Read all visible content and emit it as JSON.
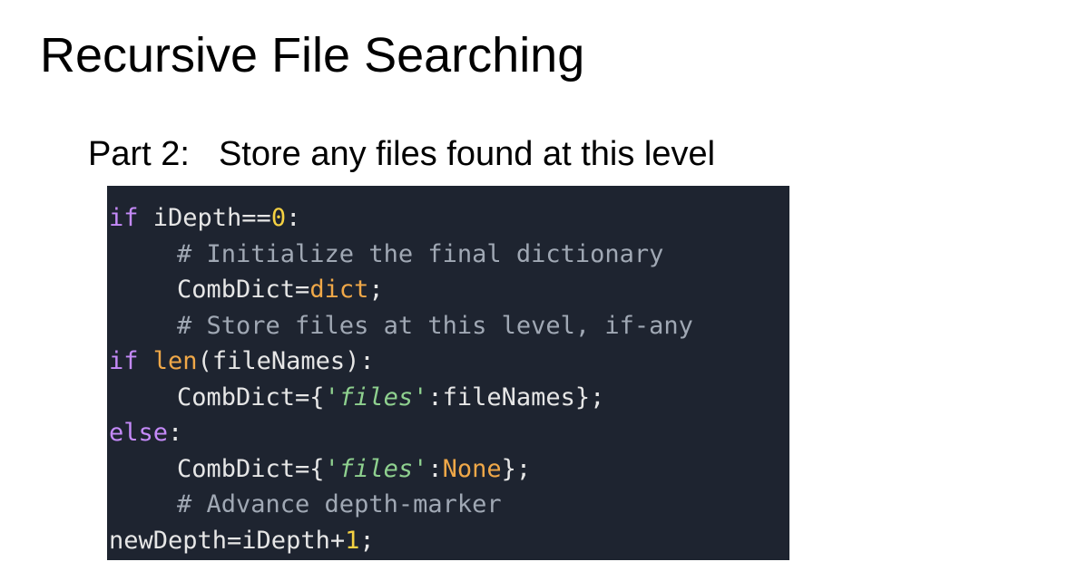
{
  "slide": {
    "title": "Recursive File Searching",
    "part_label": "Part 2:",
    "part_description": "Store any files found at this level"
  },
  "code": {
    "line1": {
      "kw": "if",
      "a": " iDepth==",
      "num": "0",
      "b": ":"
    },
    "line2": {
      "comment": "# Initialize the final dictionary"
    },
    "line3": {
      "a": "CombDict=",
      "builtin": "dict",
      "b": ";"
    },
    "line4": {
      "comment": "# Store files at this level, if-any"
    },
    "line5": {
      "kw": "if",
      "sp": " ",
      "builtin": "len",
      "b": "(fileNames):"
    },
    "line6": {
      "a": "CombDict={",
      "str": "'files'",
      "b": ":fileNames};"
    },
    "line7": {
      "kw": "else",
      "b": ":"
    },
    "line8": {
      "a": "CombDict={",
      "str": "'files'",
      "c": ":",
      "builtin": "None",
      "b": "};"
    },
    "line9": {
      "comment": "# Advance depth-marker"
    },
    "line10": {
      "a": "newDepth=iDepth+",
      "num": "1",
      "b": ";"
    }
  },
  "colors": {
    "code_background": "#1e2430",
    "keyword": "#c58af9",
    "number": "#f5d142",
    "builtin": "#f0a848",
    "string": "#8fd18f",
    "comment": "#a0a8b4"
  }
}
